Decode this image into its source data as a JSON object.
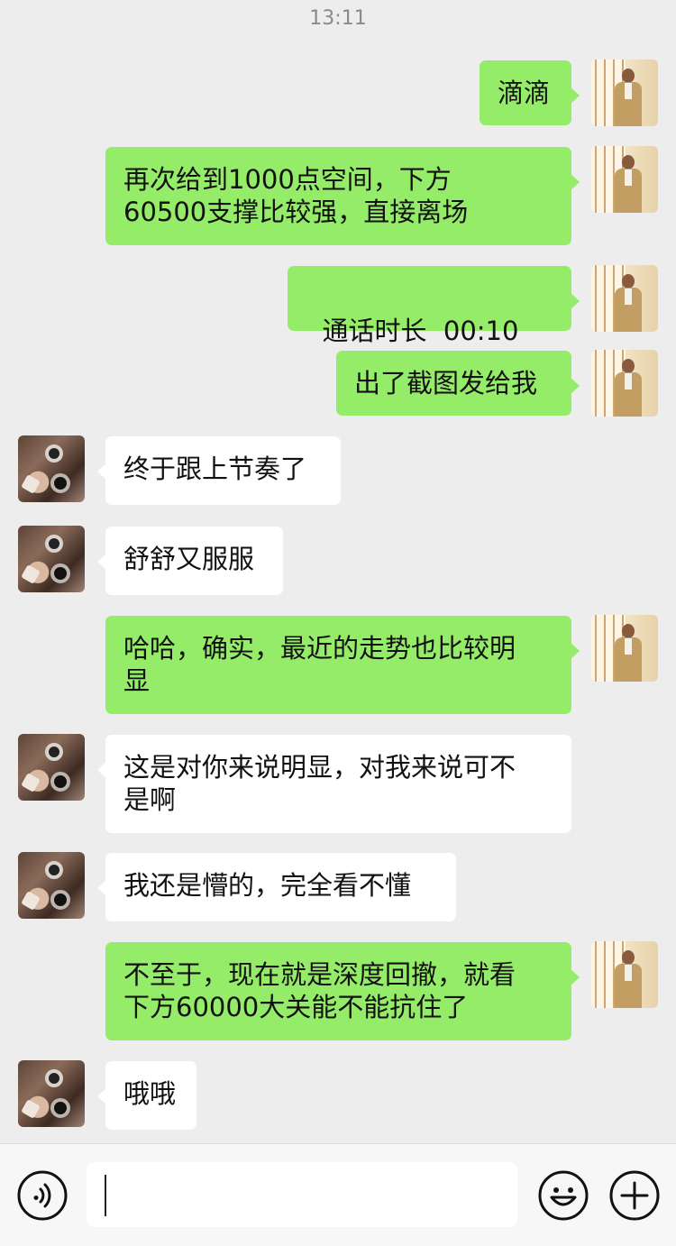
{
  "status": {
    "time": "13:11"
  },
  "messages": [
    {
      "side": "out",
      "text": "滴滴"
    },
    {
      "side": "out",
      "text": "再次给到1000点空间，下方\n60500支撑比较强，直接离场"
    },
    {
      "side": "out",
      "type": "call",
      "text": "通话时长  00:10"
    },
    {
      "side": "out",
      "text": "出了截图发给我"
    },
    {
      "side": "in",
      "text": "终于跟上节奏了"
    },
    {
      "side": "in",
      "text": "舒舒又服服"
    },
    {
      "side": "out",
      "text": "哈哈，确实，最近的走势也比较明\n显"
    },
    {
      "side": "in",
      "text": "这是对你来说明显，对我来说可不\n是啊"
    },
    {
      "side": "in",
      "text": "我还是懵的，完全看不懂"
    },
    {
      "side": "out",
      "text": "不至于，现在就是深度回撤，就看\n下方60000大关能不能抗住了"
    },
    {
      "side": "in",
      "text": "哦哦"
    }
  ],
  "input_bar": {
    "voice_icon": "voice-mode-icon",
    "emoji_icon": "emoji-icon",
    "plus_icon": "plus-icon",
    "text_value": ""
  }
}
